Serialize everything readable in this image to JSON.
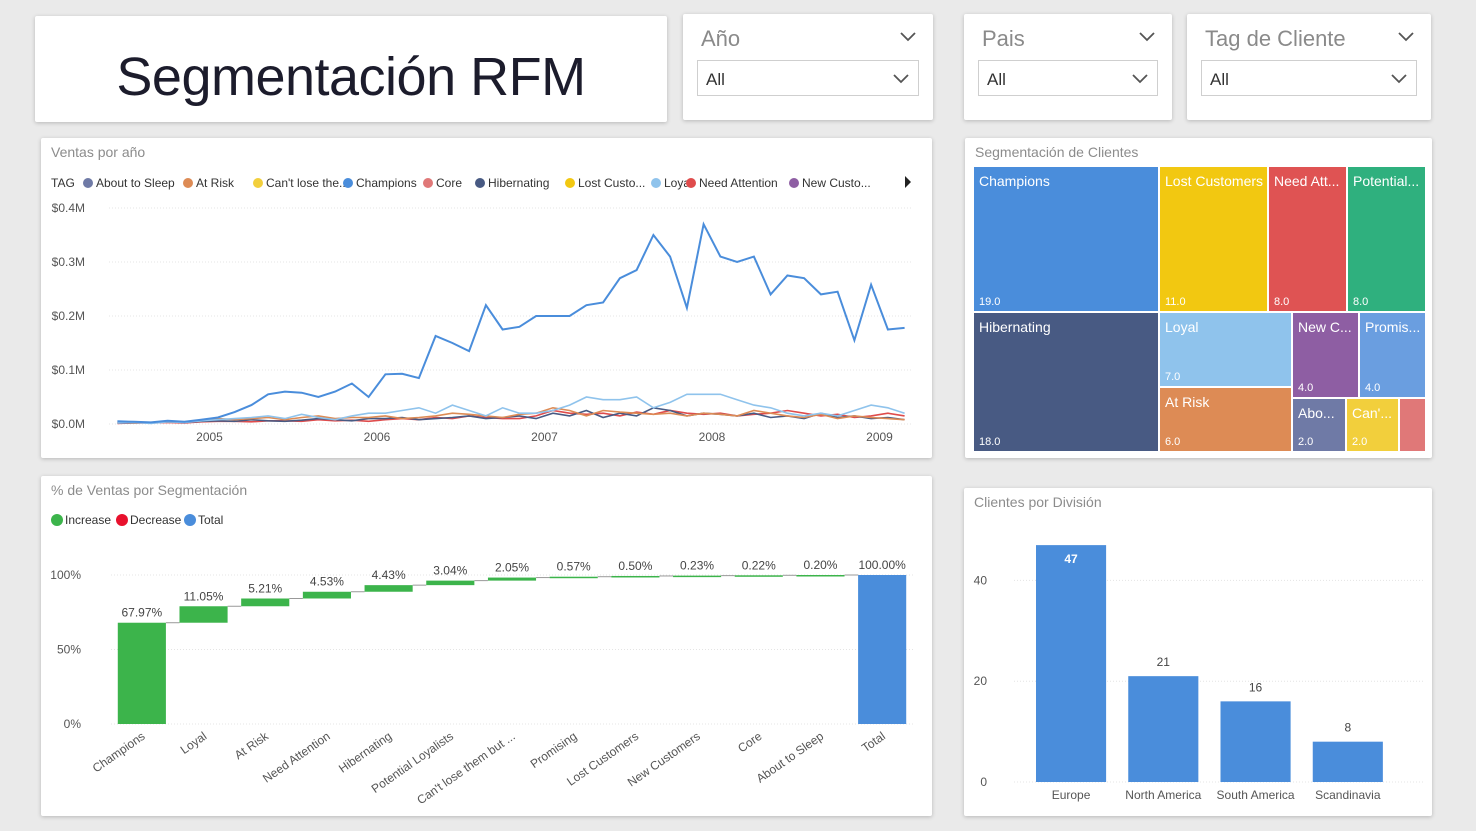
{
  "header": {
    "title": "Segmentación RFM"
  },
  "slicers": [
    {
      "label": "Año",
      "value": "All"
    },
    {
      "label": "Pais",
      "value": "All"
    },
    {
      "label": "Tag de Cliente",
      "value": "All"
    }
  ],
  "line_visual": {
    "title": "Ventas por año",
    "legend_title": "TAG",
    "legend_items": [
      {
        "label": "About to Sleep",
        "color": "#6f7aa6"
      },
      {
        "label": "At Risk",
        "color": "#dd8b55"
      },
      {
        "label": "Can't lose the...",
        "color": "#f2cf3c"
      },
      {
        "label": "Champions",
        "color": "#4a8ddb"
      },
      {
        "label": "Core",
        "color": "#e07878"
      },
      {
        "label": "Hibernating",
        "color": "#485a83"
      },
      {
        "label": "Lost Custo...",
        "color": "#f2c811"
      },
      {
        "label": "Loyal",
        "color": "#8fc3ec"
      },
      {
        "label": "Need Attention",
        "color": "#df4c4c"
      },
      {
        "label": "New Custo...",
        "color": "#8e5ea3"
      }
    ]
  },
  "treemap_visual": {
    "title": "Segmentación de Clientes",
    "cells": [
      {
        "label": "Champions",
        "value": "19.0",
        "color": "#4a8ddb"
      },
      {
        "label": "Hibernating",
        "value": "18.0",
        "color": "#485a83"
      },
      {
        "label": "Lost Customers",
        "value": "11.0",
        "color": "#f2c811"
      },
      {
        "label": "Need Att...",
        "value": "8.0",
        "color": "#df5353"
      },
      {
        "label": "Potential...",
        "value": "8.0",
        "color": "#2fb07e"
      },
      {
        "label": "Loyal",
        "value": "7.0",
        "color": "#8fc3ec"
      },
      {
        "label": "New C...",
        "value": "4.0",
        "color": "#8e5ea3"
      },
      {
        "label": "Promis...",
        "value": "4.0",
        "color": "#6a9ee0"
      },
      {
        "label": "At Risk",
        "value": "6.0",
        "color": "#dd8b55"
      },
      {
        "label": "Abo...",
        "value": "2.0",
        "color": "#6f7aa6"
      },
      {
        "label": "Can'...",
        "value": "2.0",
        "color": "#f2cf3c"
      },
      {
        "label": "",
        "value": "",
        "color": "#e07878"
      }
    ]
  },
  "waterfall_visual": {
    "title": "% de Ventas por Segmentación",
    "legend_items": [
      {
        "label": "Increase",
        "color": "#3cb44b"
      },
      {
        "label": "Decrease",
        "color": "#e8112d"
      },
      {
        "label": "Total",
        "color": "#4a8ddb"
      }
    ]
  },
  "bar_visual": {
    "title": "Clientes por División"
  },
  "chart_data": [
    {
      "type": "line",
      "title": "Ventas por año",
      "legend_title": "TAG",
      "x_ticks": [
        "2005",
        "2006",
        "2007",
        "2008",
        "2009"
      ],
      "y_ticks": [
        "$0.0M",
        "$0.1M",
        "$0.2M",
        "$0.3M",
        "$0.4M"
      ],
      "ylim": [
        0,
        0.4
      ],
      "x": [
        2004.45,
        2004.55,
        2004.65,
        2004.75,
        2004.85,
        2004.95,
        2005.05,
        2005.15,
        2005.25,
        2005.35,
        2005.45,
        2005.55,
        2005.65,
        2005.75,
        2005.85,
        2005.95,
        2006.05,
        2006.15,
        2006.25,
        2006.35,
        2006.45,
        2006.55,
        2006.65,
        2006.75,
        2006.85,
        2006.95,
        2007.05,
        2007.15,
        2007.25,
        2007.35,
        2007.45,
        2007.55,
        2007.65,
        2007.75,
        2007.85,
        2007.95,
        2008.05,
        2008.15,
        2008.25,
        2008.35,
        2008.45,
        2008.55,
        2008.65,
        2008.75,
        2008.85,
        2008.95,
        2009.05,
        2009.15
      ],
      "series": [
        {
          "name": "Champions",
          "values": [
            0.005,
            0.004,
            0.003,
            0.006,
            0.004,
            0.008,
            0.012,
            0.022,
            0.035,
            0.055,
            0.06,
            0.058,
            0.05,
            0.06,
            0.075,
            0.05,
            0.092,
            0.093,
            0.085,
            0.163,
            0.15,
            0.135,
            0.22,
            0.175,
            0.18,
            0.2,
            0.2,
            0.2,
            0.22,
            0.225,
            0.27,
            0.285,
            0.35,
            0.31,
            0.215,
            0.37,
            0.31,
            0.3,
            0.31,
            0.24,
            0.275,
            0.27,
            0.24,
            0.245,
            0.155,
            0.258,
            0.175,
            0.178
          ]
        },
        {
          "name": "Loyal",
          "values": [
            0.002,
            0.003,
            0.001,
            0.004,
            0.003,
            0.006,
            0.008,
            0.01,
            0.012,
            0.015,
            0.01,
            0.018,
            0.012,
            0.008,
            0.015,
            0.02,
            0.02,
            0.025,
            0.03,
            0.02,
            0.035,
            0.025,
            0.015,
            0.03,
            0.02,
            0.02,
            0.025,
            0.035,
            0.05,
            0.045,
            0.045,
            0.05,
            0.03,
            0.04,
            0.055,
            0.055,
            0.055,
            0.045,
            0.035,
            0.03,
            0.02,
            0.015,
            0.02,
            0.015,
            0.025,
            0.035,
            0.03,
            0.02
          ]
        },
        {
          "name": "At Risk",
          "values": [
            0.003,
            0.002,
            0.003,
            0.005,
            0.004,
            0.006,
            0.01,
            0.008,
            0.01,
            0.012,
            0.008,
            0.012,
            0.015,
            0.01,
            0.012,
            0.012,
            0.015,
            0.01,
            0.012,
            0.015,
            0.02,
            0.018,
            0.015,
            0.012,
            0.018,
            0.02,
            0.03,
            0.025,
            0.015,
            0.025,
            0.022,
            0.02,
            0.018,
            0.02,
            0.015,
            0.02,
            0.018,
            0.015,
            0.025,
            0.02,
            0.015,
            0.012,
            0.018,
            0.01,
            0.015,
            0.012,
            0.01,
            0.008
          ]
        },
        {
          "name": "Hibernating",
          "values": [
            0.002,
            0.002,
            0.003,
            0.004,
            0.003,
            0.005,
            0.006,
            0.005,
            0.008,
            0.006,
            0.005,
            0.007,
            0.01,
            0.008,
            0.006,
            0.01,
            0.01,
            0.012,
            0.008,
            0.01,
            0.012,
            0.015,
            0.01,
            0.012,
            0.015,
            0.01,
            0.02,
            0.015,
            0.025,
            0.012,
            0.02,
            0.015,
            0.03,
            0.025,
            0.015,
            0.02,
            0.018,
            0.015,
            0.02,
            0.012,
            0.015,
            0.01,
            0.02,
            0.012,
            0.015,
            0.01,
            0.012,
            0.008
          ]
        },
        {
          "name": "Need Attention",
          "values": [
            0.001,
            0.002,
            0.002,
            0.003,
            0.002,
            0.004,
            0.005,
            0.005,
            0.004,
            0.006,
            0.006,
            0.005,
            0.008,
            0.006,
            0.007,
            0.005,
            0.008,
            0.01,
            0.008,
            0.012,
            0.01,
            0.015,
            0.012,
            0.01,
            0.01,
            0.015,
            0.025,
            0.02,
            0.018,
            0.02,
            0.015,
            0.022,
            0.018,
            0.025,
            0.02,
            0.018,
            0.02,
            0.015,
            0.018,
            0.02,
            0.025,
            0.02,
            0.015,
            0.018,
            0.012,
            0.015,
            0.02,
            0.015
          ]
        }
      ]
    },
    {
      "type": "treemap",
      "title": "Segmentación de Clientes",
      "labels": [
        "Champions",
        "Hibernating",
        "Lost Customers",
        "Need Attention",
        "Potential Loyalists",
        "Loyal",
        "New Customers",
        "Promising",
        "At Risk",
        "About to Sleep",
        "Can't lose them",
        "Core"
      ],
      "values": [
        19,
        18,
        11,
        8,
        8,
        7,
        4,
        4,
        6,
        2,
        2,
        1
      ]
    },
    {
      "type": "bar",
      "subtype": "waterfall",
      "title": "% de Ventas por Segmentación",
      "categories": [
        "Champions",
        "Loyal",
        "At Risk",
        "Need Attention",
        "Hibernating",
        "Potential Loyalists",
        "Can't lose them but ...",
        "Promising",
        "Lost Customers",
        "New Customers",
        "Core",
        "About to Sleep",
        "Total"
      ],
      "values": [
        67.97,
        11.05,
        5.21,
        4.53,
        4.43,
        3.04,
        2.05,
        0.57,
        0.5,
        0.23,
        0.22,
        0.2,
        100
      ],
      "labels": [
        "67.97%",
        "11.05%",
        "5.21%",
        "4.53%",
        "4.43%",
        "3.04%",
        "2.05%",
        "0.57%",
        "0.50%",
        "0.23%",
        "0.22%",
        "0.20%",
        "100.00%"
      ],
      "y_ticks": [
        "0%",
        "50%",
        "100%"
      ],
      "ylim": [
        0,
        100
      ]
    },
    {
      "type": "bar",
      "title": "Clientes por División",
      "categories": [
        "Europe",
        "North America",
        "South America",
        "Scandinavia"
      ],
      "values": [
        47,
        21,
        16,
        8
      ],
      "y_ticks": [
        "0",
        "20",
        "40"
      ],
      "ylim": [
        0,
        50
      ]
    }
  ]
}
